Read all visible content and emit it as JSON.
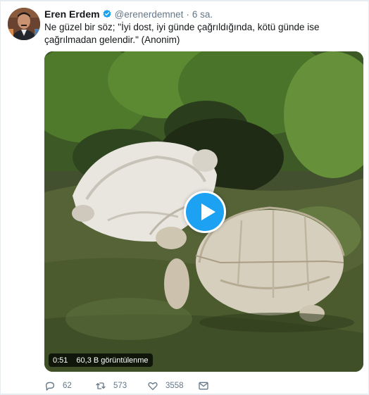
{
  "tweet": {
    "display_name": "Eren Erdem",
    "handle": "@erenerdemnet",
    "separator": "·",
    "time": "6 sa.",
    "text": "Ne güzel bir söz; \"İyi dost, iyi günde çağrıldığında, kötü günde ise çağrılmadan gelendir.\" (Anonim)"
  },
  "video": {
    "duration": "0:51",
    "views": "60,3 B görüntülenme"
  },
  "actions": {
    "reply_count": "62",
    "retweet_count": "573",
    "like_count": "3558"
  },
  "icons": {
    "verified": "verified-badge-icon",
    "play": "play-icon",
    "reply": "reply-icon",
    "retweet": "retweet-icon",
    "like": "heart-icon",
    "message": "envelope-icon"
  },
  "colors": {
    "accent": "#1da1f2",
    "text": "#14171a",
    "muted": "#657786"
  }
}
